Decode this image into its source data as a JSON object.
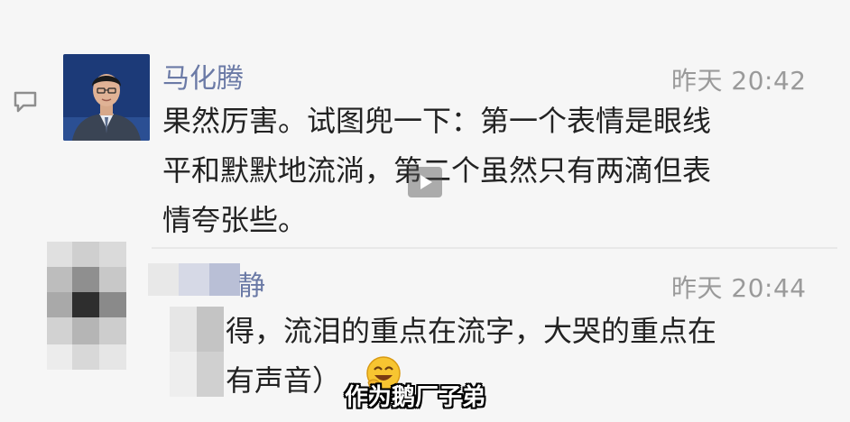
{
  "comments": [
    {
      "author": "马化腾",
      "time": "昨天 20:42",
      "lines": [
        "果然厉害。试图兜一下：第一个表情是眼线",
        "平和默默地流淌，第二个虽然只有两滴但表",
        "情夸张些。"
      ]
    },
    {
      "author_visible": "静",
      "time": "昨天 20:44",
      "lines": [
        "得，流泪的重点在流字，大哭的重点在",
        "有声音）"
      ]
    }
  ],
  "video_subtitle": "作为鹅厂子弟",
  "icons": {
    "comment": "comment-bubble-icon",
    "play": "play-icon",
    "emoji": "grinning-face-emoji"
  },
  "colors": {
    "author_name": "#6b7aa6",
    "timestamp": "#9a9a9a",
    "text": "#222222",
    "avatar_bg": "#1c3a78"
  }
}
